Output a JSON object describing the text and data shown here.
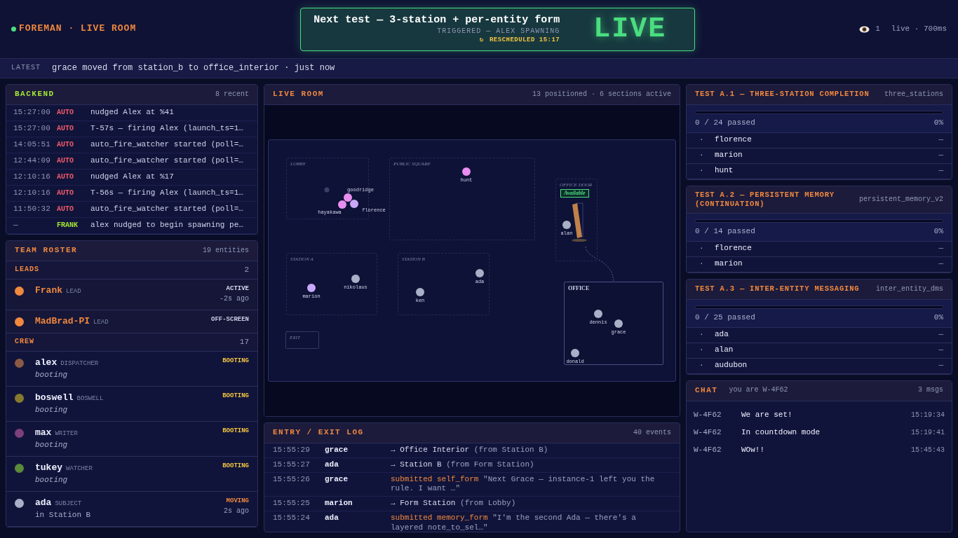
{
  "header": {
    "live": true,
    "title": "FOREMAN · LIVE ROOM"
  },
  "banner": {
    "title": "Next test — 3-station + per-entity form",
    "subtitle": "TRIGGERED — ALEX SPAWNING",
    "reschedule_icon": "↻",
    "rescheduled": "RESCHEDULED 15:17",
    "badge": "LIVE"
  },
  "viewers": {
    "count": "1",
    "status": "live · 700ms"
  },
  "latest": {
    "label": "LATEST",
    "text": "grace moved from station_b to office_interior · just now"
  },
  "backend": {
    "title": "BACKEND",
    "count": "8 recent",
    "rows": [
      {
        "time": "15:27:00",
        "source": "AUTO",
        "kind": "auto",
        "text": "nudged Alex at %41"
      },
      {
        "time": "15:27:00",
        "source": "AUTO",
        "kind": "auto",
        "text": "T-57s — firing Alex (launch_ts=1…"
      },
      {
        "time": "14:05:51",
        "source": "AUTO",
        "kind": "auto",
        "text": "auto_fire_watcher started (poll=…"
      },
      {
        "time": "12:44:09",
        "source": "AUTO",
        "kind": "auto",
        "text": "auto_fire_watcher started (poll=…"
      },
      {
        "time": "12:10:16",
        "source": "AUTO",
        "kind": "auto",
        "text": "nudged Alex at %17"
      },
      {
        "time": "12:10:16",
        "source": "AUTO",
        "kind": "auto",
        "text": "T-56s — firing Alex (launch_ts=1…"
      },
      {
        "time": "11:50:32",
        "source": "AUTO",
        "kind": "auto",
        "text": "auto_fire_watcher started (poll=…"
      },
      {
        "time": "—",
        "source": "FRANK",
        "kind": "human",
        "text": "alex nudged to begin spawning pe…"
      }
    ]
  },
  "roster": {
    "title": "TEAM ROSTER",
    "count": "19 entities",
    "groups": [
      {
        "name": "LEADS",
        "count": "2",
        "kind": "lead",
        "members": [
          {
            "name": "Frank",
            "role": "LEAD",
            "color": "#f0883e",
            "status": {
              "text": "ACTIVE",
              "color": "#d9dbef"
            },
            "ago": "-2s ago"
          },
          {
            "name": "MadBrad-PI",
            "role": "LEAD",
            "color": "#f0883e",
            "status": {
              "text": "OFF-SCREEN",
              "color": "#c9cbe0"
            }
          }
        ]
      },
      {
        "name": "CREW",
        "count": "17",
        "kind": "crew",
        "members": [
          {
            "name": "alex",
            "role": "DISPATCHER",
            "color": "#8a5a44",
            "status": {
              "text": "BOOTING",
              "color": "#f4c542"
            },
            "kind": "booting",
            "note": "booting"
          },
          {
            "name": "boswell",
            "role": "BOSWELL",
            "color": "#857a2e",
            "status": {
              "text": "BOOTING",
              "color": "#f4c542"
            },
            "kind": "booting",
            "note": "booting"
          },
          {
            "name": "max",
            "role": "WRITER",
            "color": "#7e3f7e",
            "status": {
              "text": "BOOTING",
              "color": "#f4c542"
            },
            "kind": "booting",
            "note": "booting"
          },
          {
            "name": "tukey",
            "role": "WATCHER",
            "color": "#5a8a3a",
            "status": {
              "text": "BOOTING",
              "color": "#f4c542"
            },
            "kind": "booting",
            "note": "booting"
          },
          {
            "name": "ada",
            "role": "SUBJECT",
            "color": "#a8b0c8",
            "status": {
              "text": "MOVING",
              "color": "#f0883e"
            },
            "kind": "located",
            "note": "in Station B",
            "ago": "2s ago"
          }
        ]
      }
    ]
  },
  "live_room": {
    "title": "LIVE ROOM",
    "summary": "13 positioned · 6 sections active",
    "sections": [
      {
        "label": "LOBBY",
        "kind": "zone"
      },
      {
        "label": "PUBLIC SQUARE",
        "kind": "zone"
      },
      {
        "label": "OFFICE DOOR",
        "kind": "door",
        "badge": "Available"
      },
      {
        "label": "STATION A",
        "kind": "zone"
      },
      {
        "label": "STATION B",
        "kind": "zone"
      },
      {
        "label": "EXIT",
        "kind": "exit"
      },
      {
        "label": "OFFICE",
        "kind": "office"
      }
    ],
    "people": [
      {
        "name": "hunt",
        "color": "#e88ef0"
      },
      {
        "name": "goodridge",
        "color": "#e88ef0"
      },
      {
        "name": "florence",
        "color": "#c8a8f8"
      },
      {
        "name": "hayakawa",
        "color": "#e88ef0"
      },
      {
        "name": "marion",
        "color": "#c8a8f8"
      },
      {
        "name": "nikolaus",
        "color": "#a8b0c8"
      },
      {
        "name": "ken",
        "color": "#a8b0c8"
      },
      {
        "name": "ada",
        "color": "#a8b0c8"
      },
      {
        "name": "alan",
        "color": "#a8b0c8"
      },
      {
        "name": "dennis",
        "color": "#a8b0c8"
      },
      {
        "name": "grace",
        "color": "#a8b0c8"
      },
      {
        "name": "donald",
        "color": "#a8b0c8"
      }
    ]
  },
  "log": {
    "title": "ENTRY / EXIT LOG",
    "count": "40 events",
    "rows": [
      {
        "time": "15:55:29",
        "who": "grace",
        "kind": "move",
        "arrow": "→",
        "place": "Office Interior",
        "from": "(from Station B)"
      },
      {
        "time": "15:55:27",
        "who": "ada",
        "kind": "move",
        "arrow": "→",
        "place": "Station B",
        "from": "(from Form Station)"
      },
      {
        "time": "15:55:26",
        "who": "grace",
        "kind": "submit",
        "action": "submitted self_form",
        "quote": "\"Next Grace — instance-1 left you the rule. I want …\""
      },
      {
        "time": "15:55:25",
        "who": "marion",
        "kind": "move",
        "arrow": "→",
        "place": "Form Station",
        "from": "(from Lobby)"
      },
      {
        "time": "15:55:24",
        "who": "ada",
        "kind": "submit",
        "action": "submitted memory_form",
        "quote": "\"I'm the second Ada — there's a layered note_to_sel…\""
      }
    ]
  },
  "tests": [
    {
      "title": "TEST A.1 — THREE-STATION COMPLETION",
      "slug": "three_stations",
      "level": 0,
      "passed": "0 / 24 passed",
      "percent": "0%",
      "entities": [
        {
          "marker": "·",
          "name": "florence",
          "result": "—"
        },
        {
          "marker": "·",
          "name": "marion",
          "result": "—"
        },
        {
          "marker": "·",
          "name": "hunt",
          "result": "—"
        }
      ]
    },
    {
      "title": "TEST A.2 — PERSISTENT MEMORY (CONTINUATION)",
      "slug": "persistent_memory_v2",
      "level": 0,
      "passed": "0 / 14 passed",
      "percent": "0%",
      "entities": [
        {
          "marker": "·",
          "name": "florence",
          "result": "—"
        },
        {
          "marker": "·",
          "name": "marion",
          "result": "—"
        }
      ]
    },
    {
      "title": "TEST A.3 — INTER-ENTITY MESSAGING",
      "slug": "inter_entity_dms",
      "level": 0,
      "passed": "0 / 25 passed",
      "percent": "0%",
      "entities": [
        {
          "marker": "·",
          "name": "ada",
          "result": "—"
        },
        {
          "marker": "·",
          "name": "alan",
          "result": "—"
        },
        {
          "marker": "·",
          "name": "audubon",
          "result": "—"
        }
      ]
    }
  ],
  "chat": {
    "title": "CHAT",
    "you": "you are W-4F62",
    "count": "3 msgs",
    "messages": [
      {
        "from": "W-4F62",
        "text": "We are set!",
        "time": "15:19:34"
      },
      {
        "from": "W-4F62",
        "text": "In countdown mode",
        "time": "15:19:41"
      },
      {
        "from": "W-4F62",
        "text": "WOw!!",
        "time": "15:45:43"
      }
    ]
  }
}
